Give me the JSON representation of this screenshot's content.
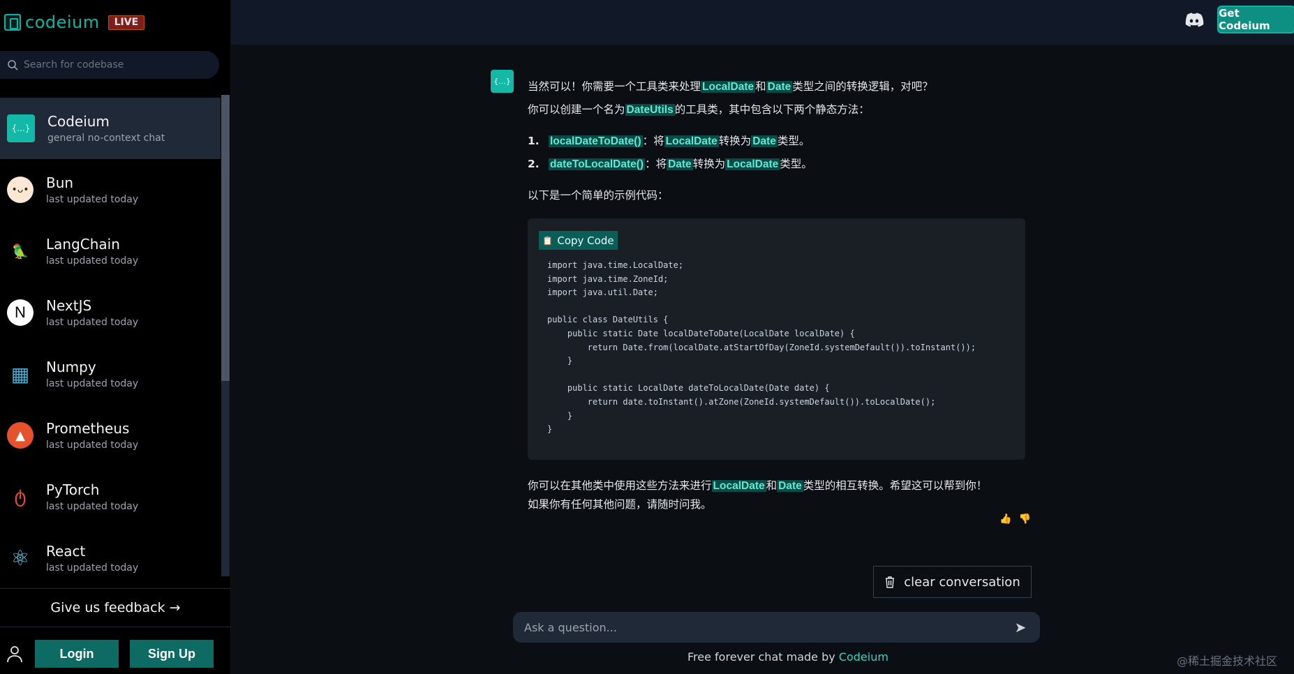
{
  "brand": {
    "name": "codeium",
    "badge": "LIVE"
  },
  "search": {
    "placeholder": "Search for codebase"
  },
  "sidebar": {
    "items": [
      {
        "name": "Codeium",
        "sub": "general no-context chat"
      },
      {
        "name": "Bun",
        "sub": "last updated today"
      },
      {
        "name": "LangChain",
        "sub": "last updated today"
      },
      {
        "name": "NextJS",
        "sub": "last updated today"
      },
      {
        "name": "Numpy",
        "sub": "last updated today"
      },
      {
        "name": "Prometheus",
        "sub": "last updated today"
      },
      {
        "name": "PyTorch",
        "sub": "last updated today"
      },
      {
        "name": "React",
        "sub": "last updated today"
      }
    ]
  },
  "feedback": "Give us feedback →",
  "auth": {
    "login": "Login",
    "signup": "Sign Up"
  },
  "topbar": {
    "get_btn": "Get Codeium"
  },
  "message": {
    "avatar_label": "{...}",
    "line1": [
      "当然可以！你需要一个工具类来处理",
      "LocalDate",
      "和",
      "Date",
      "类型之间的转换逻辑，对吧？"
    ],
    "line2": [
      "你可以创建一个名为",
      "DateUtils",
      "的工具类，其中包含以下两个静态方法："
    ],
    "list": [
      {
        "num": "1.",
        "code": "localDateToDate()",
        "a": "：将",
        "x": "LocalDate",
        "b": "转换为",
        "y": "Date",
        "c": "类型。"
      },
      {
        "num": "2.",
        "code": "dateToLocalDate()",
        "a": "：将",
        "x": "Date",
        "b": "转换为",
        "y": "LocalDate",
        "c": "类型。"
      }
    ],
    "example_intro": "以下是一个简单的示例代码：",
    "copy_label": "Copy Code",
    "code": "import java.time.LocalDate;\nimport java.time.ZoneId;\nimport java.util.Date;\n\npublic class DateUtils {\n    public static Date localDateToDate(LocalDate localDate) {\n        return Date.from(localDate.atStartOfDay(ZoneId.systemDefault()).toInstant());\n    }\n\n    public static LocalDate dateToLocalDate(Date date) {\n        return date.toInstant().atZone(ZoneId.systemDefault()).toLocalDate();\n    }\n}",
    "closing1": [
      "你可以在其他类中使用这些方法来进行",
      "LocalDate",
      "和",
      "Date",
      "类型的相互转换。希望这可以帮到你！"
    ],
    "closing2": "如果你有任何其他问题，请随时问我。"
  },
  "clear_label": "clear conversation",
  "ask": {
    "placeholder": "Ask a question..."
  },
  "footer": {
    "text": "Free forever chat made by ",
    "link": "Codeium"
  },
  "watermark": "@稀土掘金技术社区"
}
